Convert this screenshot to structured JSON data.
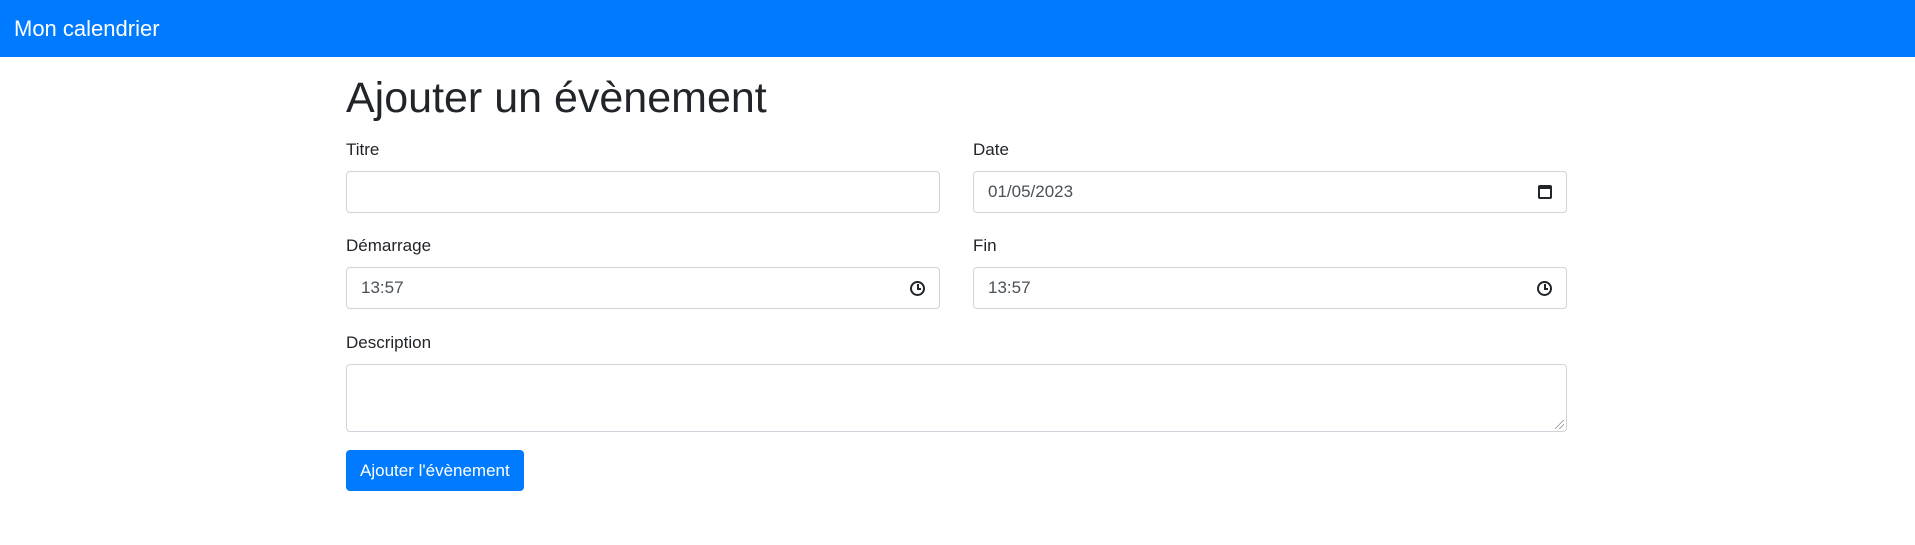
{
  "navbar": {
    "brand": "Mon calendrier"
  },
  "page": {
    "title": "Ajouter un évènement"
  },
  "form": {
    "titre": {
      "label": "Titre",
      "value": "",
      "placeholder": ""
    },
    "date": {
      "label": "Date",
      "value": "01/05/2023",
      "icon": "calendar-icon"
    },
    "demarrage": {
      "label": "Démarrage",
      "value": "13:57",
      "icon": "clock-icon"
    },
    "fin": {
      "label": "Fin",
      "value": "13:57",
      "icon": "clock-icon"
    },
    "description": {
      "label": "Description",
      "value": ""
    },
    "submit_label": "Ajouter l'évènement"
  },
  "colors": {
    "primary": "#007bff",
    "text": "#212529",
    "input_border": "#ced4da"
  }
}
